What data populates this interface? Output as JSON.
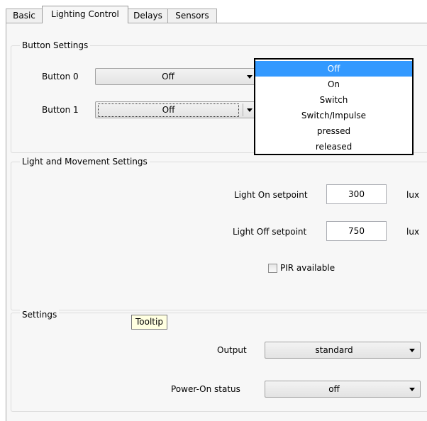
{
  "tabs": [
    {
      "label": "Basic",
      "active": false
    },
    {
      "label": "Lighting Control",
      "active": true
    },
    {
      "label": "Delays",
      "active": false
    },
    {
      "label": "Sensors",
      "active": false
    }
  ],
  "button_settings": {
    "title": "Button Settings",
    "button0": {
      "label": "Button 0",
      "value": "Off"
    },
    "button1": {
      "label": "Button 1",
      "value": "Off"
    }
  },
  "dropdown": {
    "options": [
      "Off",
      "On",
      "Switch",
      "Switch/Impulse",
      "pressed",
      "released"
    ],
    "selected": "Off",
    "highlight_color": "#3399ff"
  },
  "light_movement": {
    "title": "Light and Movement Settings",
    "light_on": {
      "label": "Light On setpoint",
      "value": "300",
      "unit": "lux"
    },
    "light_off": {
      "label": "Light Off setpoint",
      "value": "750",
      "unit": "lux"
    },
    "pir": {
      "label": "PIR available",
      "checked": false
    }
  },
  "settings": {
    "title": "Settings",
    "tooltip": "Tooltip",
    "output": {
      "label": "Output",
      "value": "standard"
    },
    "power_on": {
      "label": "Power-On status",
      "value": "off"
    }
  }
}
